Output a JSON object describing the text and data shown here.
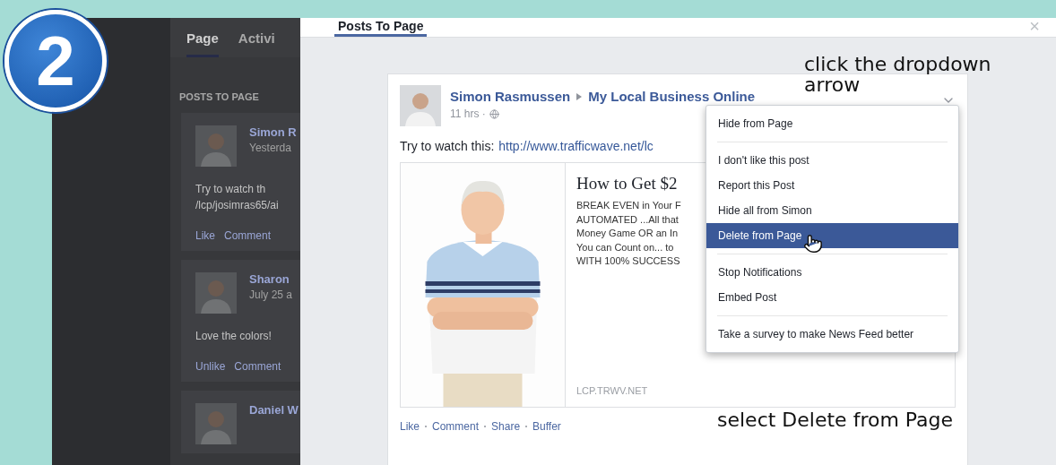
{
  "step_badge": "2",
  "background_page": {
    "tabs": [
      {
        "label": "Page",
        "selected": true
      },
      {
        "label": "Activi",
        "selected": false
      }
    ],
    "section_title": "POSTS TO PAGE",
    "posts": [
      {
        "author": "Simon R",
        "time": "Yesterda",
        "text_lines": [
          "Try to watch th",
          "/lcp/josimras65/ai"
        ],
        "actions": [
          "Like",
          "Comment"
        ]
      },
      {
        "author": "Sharon",
        "time": "July 25 a",
        "text_lines": [
          "Love the colors!"
        ],
        "actions": [
          "Unlike",
          "Comment"
        ]
      },
      {
        "author": "Daniel W"
      }
    ]
  },
  "dialog": {
    "tabs": [
      {
        "label": "Posts To Page",
        "selected": true
      }
    ],
    "close": "×",
    "post": {
      "author": "Simon Rasmussen",
      "target": "My Local Business Online",
      "meta": "11 hrs ·",
      "text": "Try to watch this:",
      "link": "http://www.trafficwave.net/lc",
      "preview": {
        "title": "How to Get $2",
        "description": [
          "BREAK EVEN in Your F",
          "AUTOMATED ...All that",
          "Money Game OR an In",
          "You can Count on... to",
          "WITH 100% SUCCESS"
        ],
        "domain": "LCP.TRWV.NET"
      },
      "actions": [
        "Like",
        "Comment",
        "Share",
        "Buffer"
      ]
    },
    "menu": {
      "groups": [
        [
          {
            "label": "Hide from Page",
            "selected": false
          }
        ],
        [
          {
            "label": "I don't like this post",
            "selected": false
          },
          {
            "label": "Report this Post",
            "selected": false
          },
          {
            "label": "Hide all from Simon",
            "selected": false
          },
          {
            "label": "Delete from Page",
            "selected": true
          }
        ],
        [
          {
            "label": "Stop Notifications",
            "selected": false
          },
          {
            "label": "Embed Post",
            "selected": false
          }
        ],
        [
          {
            "label": "Take a survey to make News Feed better",
            "selected": false
          }
        ]
      ]
    }
  },
  "annotations": [
    {
      "kind": "top",
      "text": "click the dropdown arrow"
    },
    {
      "kind": "bottom",
      "text": "select Delete from Page"
    }
  ]
}
